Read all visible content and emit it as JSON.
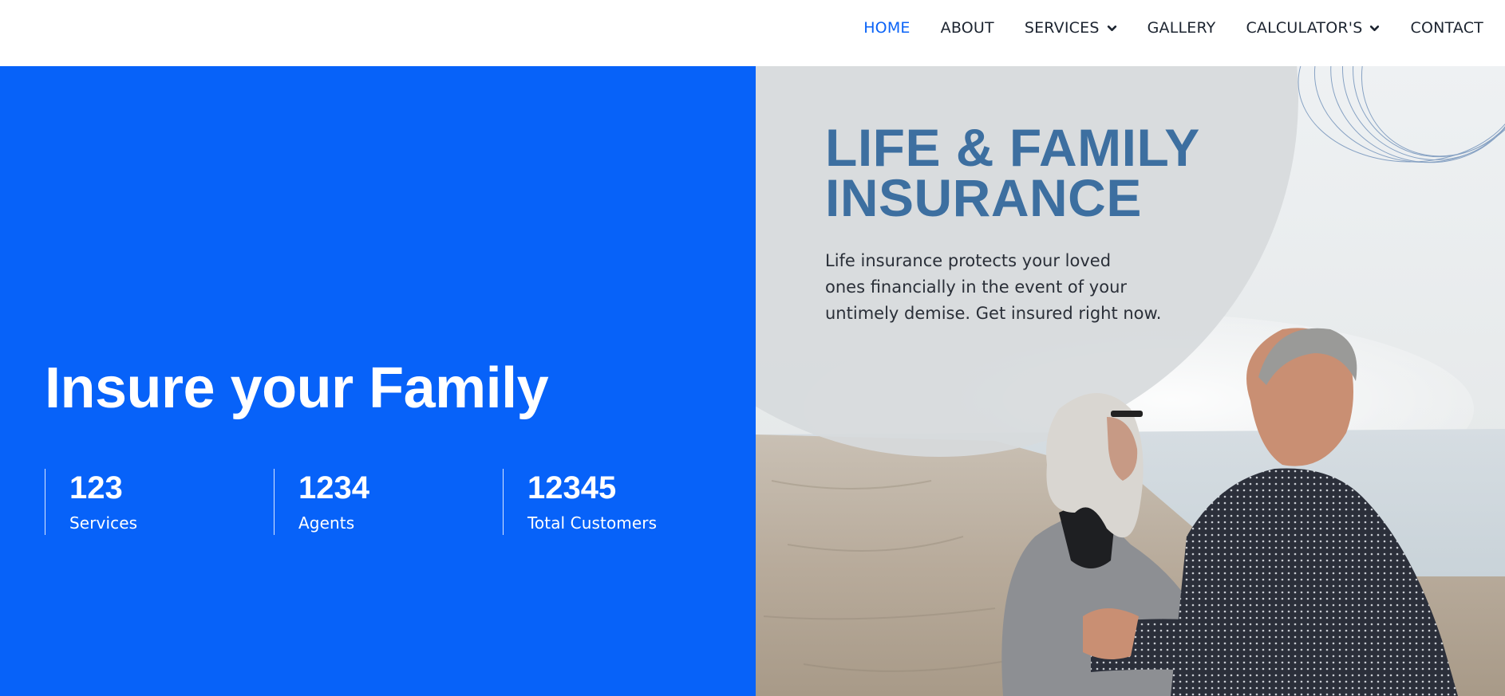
{
  "nav": {
    "items": [
      {
        "label": "HOME",
        "active": true,
        "dropdown": false
      },
      {
        "label": "ABOUT",
        "active": false,
        "dropdown": false
      },
      {
        "label": "SERVICES",
        "active": false,
        "dropdown": true
      },
      {
        "label": "GALLERY",
        "active": false,
        "dropdown": false
      },
      {
        "label": "CALCULATOR'S",
        "active": false,
        "dropdown": true
      },
      {
        "label": "CONTACT",
        "active": false,
        "dropdown": false
      }
    ]
  },
  "hero": {
    "title": "Insure your Family",
    "stats": [
      {
        "value": "123",
        "label": "Services"
      },
      {
        "value": "1234",
        "label": "Agents"
      },
      {
        "value": "12345",
        "label": "Total Customers"
      }
    ]
  },
  "promo": {
    "title_lines": [
      "LIFE & FAMILY",
      "INSURANCE"
    ],
    "text_lines": [
      "Life insurance protects your loved",
      "ones financially in the event of your",
      "untimely demise. Get insured right now."
    ]
  },
  "colors": {
    "accent": "#0762f9",
    "nav_active": "#0a63f7",
    "promo_title": "#3d6fa0"
  }
}
